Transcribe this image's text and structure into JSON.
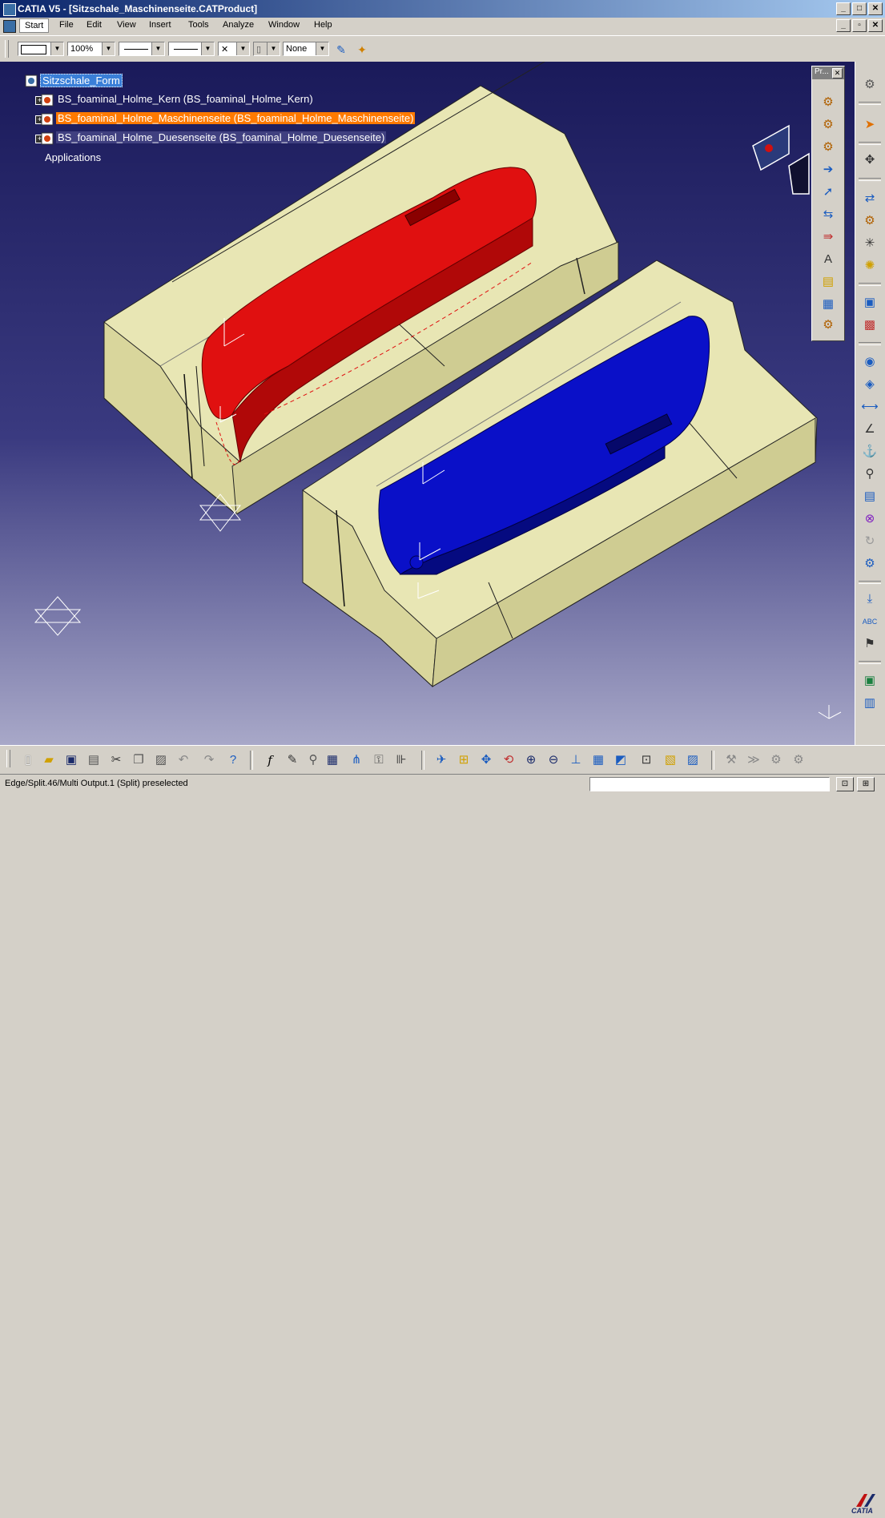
{
  "window": {
    "title": "CATIA V5 - [Sitzschale_Maschinenseite.CATProduct]",
    "minimize": "_",
    "restore": "□",
    "close": "✕"
  },
  "menu": {
    "start": "Start",
    "items": [
      "File",
      "Edit",
      "View",
      "Insert",
      "Tools",
      "Analyze",
      "Window",
      "Help"
    ],
    "doc_minimize": "_",
    "doc_restore": "▫",
    "doc_close": "✕"
  },
  "toolbar": {
    "zoom_value": "100%",
    "point_style": "✕",
    "layer_value": "None"
  },
  "tree": {
    "root": "Sitzschale_Form",
    "children": [
      "BS_foaminal_Holme_Kern (BS_foaminal_Holme_Kern)",
      "BS_foaminal_Holme_Maschinenseite (BS_foaminal_Holme_Maschinenseite)",
      "BS_foaminal_Holme_Duesenseite (BS_foaminal_Holme_Duesenseite)"
    ],
    "applications": "Applications",
    "plus": "+"
  },
  "float_toolbar": {
    "title": "Pr...",
    "close": "✕"
  },
  "status": {
    "text": "Edge/Split.46/Multi Output.1 (Split) preselected",
    "btn1": "⊡",
    "btn2": "⊞"
  },
  "logo": {
    "text": "CATIA"
  },
  "colors": {
    "viewport_top": "#1a1a5a",
    "viewport_bottom": "#a8a8c8",
    "mold_fill": "#e8e6b4",
    "red_part": "#e01010",
    "blue_part": "#0a10c8",
    "tree_highlight": "#ff7a00",
    "tree_selected": "#3a7fd8"
  }
}
